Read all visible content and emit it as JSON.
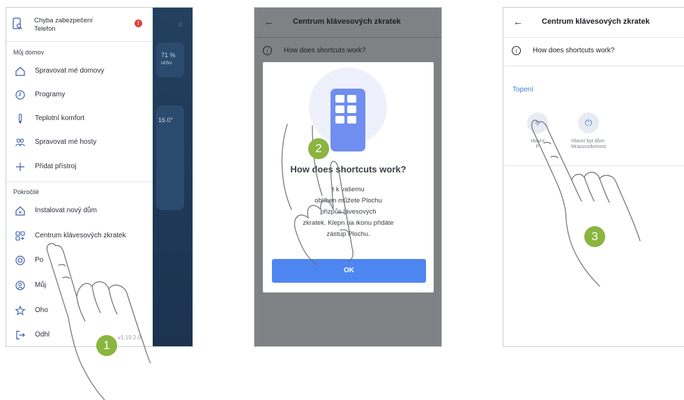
{
  "screen1": {
    "bg": {
      "value_a": "71 %",
      "value_a_sub": "uchu",
      "value_b": "16.0°"
    },
    "alert": {
      "line1": "Chyba zabezpečení",
      "line2": "Telefon",
      "badge": "!"
    },
    "section_home": "Můj domov",
    "home_items": [
      {
        "label": "Spravovat mé domovy",
        "icon": "home-icon"
      },
      {
        "label": "Programy",
        "icon": "clock-icon"
      },
      {
        "label": "Teplotní komfort",
        "icon": "thermometer-icon"
      },
      {
        "label": "Spravovat mé hosty",
        "icon": "guests-icon"
      },
      {
        "label": "Přidat přístroj",
        "icon": "plus-icon"
      }
    ],
    "section_advanced": "Pokročilé",
    "adv_items": [
      {
        "label": "Instalovat nový dům",
        "icon": "new-home-icon"
      },
      {
        "label": "Centrum klávesových zkratek",
        "icon": "shortcuts-icon"
      },
      {
        "label": "Po",
        "icon": "support-icon"
      },
      {
        "label": "Můj",
        "icon": "account-icon"
      },
      {
        "label": "Oho",
        "icon": "star-icon"
      },
      {
        "label": "Odhl",
        "icon": "logout-icon"
      }
    ],
    "version": "v1.19.2.0"
  },
  "screen2": {
    "header_title": "Centrum klávesových zkratek",
    "help_label": "How does shortcuts work?",
    "dialog": {
      "title": "How does shortcuts work?",
      "body_lines": [
        "t k vašemu",
        "oblíben    můžete Plochu",
        "přizpůs     lávesových",
        "zkratek. Klepn    na ikonu přidáte",
        "zástup      Plochu."
      ],
      "ok_label": "OK"
    }
  },
  "screen3": {
    "header_title": "Centrum klávesových zkratek",
    "help_label": "How does shortcuts work?",
    "section": "Topení",
    "shortcuts": [
      {
        "line1": "Hlavní",
        "line2": "P",
        "icon": "walking-person-icon"
      },
      {
        "line1": "Hlavní byt dům:",
        "line2": "Mrazuvzdornost",
        "icon": "power-icon"
      }
    ]
  },
  "steps": [
    "1",
    "2",
    "3"
  ],
  "colors": {
    "accent": "#4d86f0",
    "badge": "#8ab53f",
    "alert": "#e0403a",
    "link": "#3d7de0"
  }
}
